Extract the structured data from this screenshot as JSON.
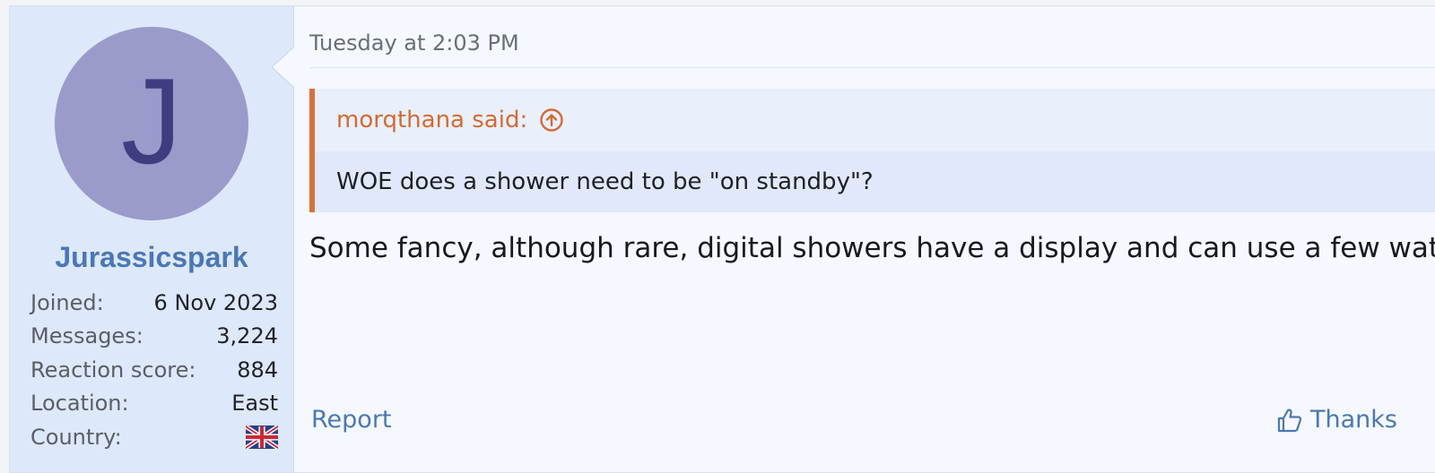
{
  "post": {
    "date": "Tuesday at 2:03 PM",
    "quote": {
      "author_line": "morqthana said:",
      "text": "WOE does a shower need to be \"on standby\"?"
    },
    "message": "Some fancy, although rare, digital showers have a display and can use a few watts.",
    "actions": {
      "report": "Report",
      "thanks": "Thanks"
    }
  },
  "user": {
    "avatar_letter": "J",
    "name": "Jurassicspark",
    "stats": [
      {
        "label": "Joined:",
        "value": "6 Nov 2023"
      },
      {
        "label": "Messages:",
        "value": "3,224"
      },
      {
        "label": "Reaction score:",
        "value": "884"
      },
      {
        "label": "Location:",
        "value": "East"
      },
      {
        "label": "Country:",
        "value": "",
        "icon": "uk-flag-icon"
      }
    ]
  },
  "colors": {
    "accent": "#4b78b4",
    "quote_accent": "#d9703a",
    "avatar_bg": "#9a9acb",
    "avatar_letter": "#3f3d7f",
    "sidebar_bg": "#dde8fa"
  }
}
